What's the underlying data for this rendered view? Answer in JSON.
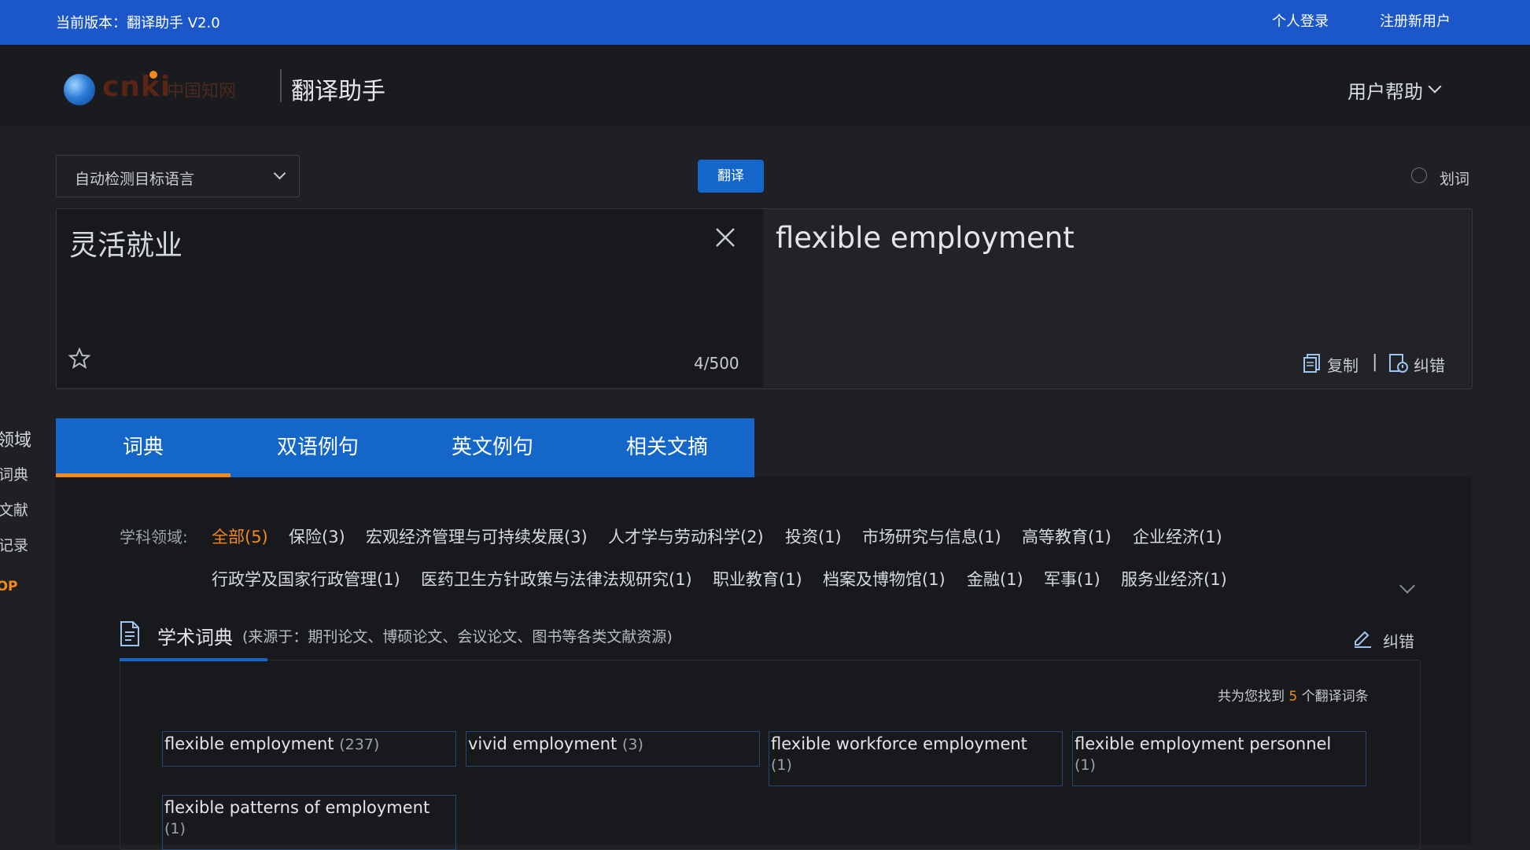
{
  "topbar": {
    "version": "当前版本：翻译助手 V2.0",
    "login": "个人登录",
    "register": "注册新用户"
  },
  "header": {
    "logo_text": "cnki",
    "logo_sub": "中国知网",
    "app_title": "翻译助手",
    "help": "用户帮助"
  },
  "controls": {
    "lang_select": "自动检测目标语言",
    "translate_btn": "翻译",
    "select_word": "划词"
  },
  "source": {
    "text": "灵活就业",
    "count": "4/500"
  },
  "target": {
    "text": "flexible employment",
    "copy": "复制",
    "separator": "|",
    "correct": "纠错"
  },
  "sidebar": {
    "head": "领域",
    "items": [
      "词典",
      "文献",
      "记录"
    ],
    "top": "TOP"
  },
  "tabs": [
    "词典",
    "双语例句",
    "英文例句",
    "相关文摘"
  ],
  "fields": {
    "label": "学科领域:",
    "row1": [
      "全部(5)",
      "保险(3)",
      "宏观经济管理与可持续发展(3)",
      "人才学与劳动科学(2)",
      "投资(1)",
      "市场研究与信息(1)",
      "高等教育(1)",
      "企业经济(1)"
    ],
    "row2": [
      "行政学及国家行政管理(1)",
      "医药卫生方针政策与法律法规研究(1)",
      "职业教育(1)",
      "档案及博物馆(1)",
      "金融(1)",
      "军事(1)",
      "服务业经济(1)"
    ]
  },
  "dictionary": {
    "title": "学术词典",
    "subtitle": "(来源于：期刊论文、博硕论文、会议论文、图书等各类文献资源)",
    "correct": "纠错",
    "found_prefix": "共为您找到",
    "found_count": "5",
    "found_suffix": "个翻译词条",
    "terms": [
      {
        "term": "flexible employment",
        "count": "(237)"
      },
      {
        "term": "vivid employment",
        "count": "(3)"
      },
      {
        "term": "flexible workforce employment",
        "count": "(1)"
      },
      {
        "term": "flexible employment personnel",
        "count": "(1)"
      },
      {
        "term": "flexible patterns of employment",
        "count": "(1)"
      }
    ]
  },
  "colors": {
    "brand_blue": "#1b57c9",
    "tab_blue": "#1467c8",
    "accent_orange": "#f28a1c"
  }
}
